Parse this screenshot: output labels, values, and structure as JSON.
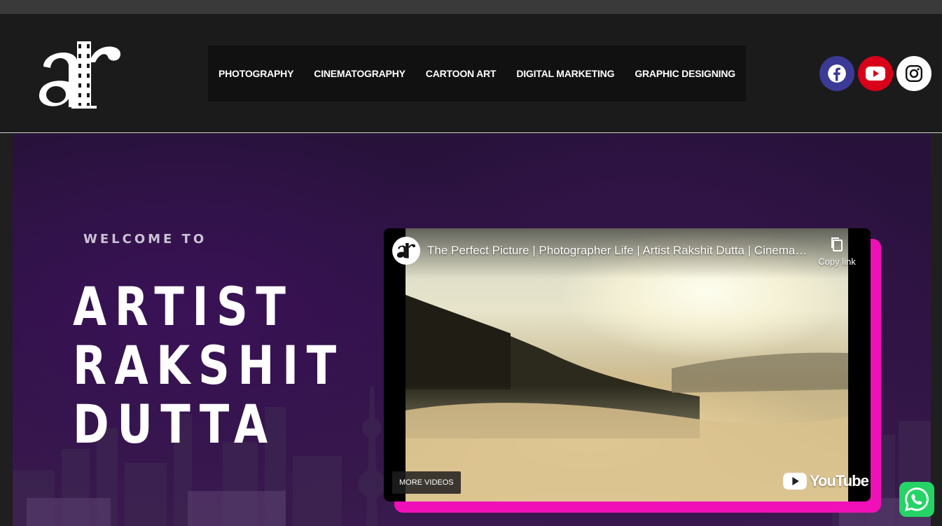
{
  "nav": {
    "items": [
      {
        "label": "PHOTOGRAPHY"
      },
      {
        "label": "CINEMATOGRAPHY"
      },
      {
        "label": "CARTOON ART"
      },
      {
        "label": "DIGITAL MARKETING"
      },
      {
        "label": "GRAPHIC DESIGNING"
      }
    ]
  },
  "social": {
    "facebook": {
      "icon": "facebook-icon",
      "color": "#3b3a96"
    },
    "youtube": {
      "icon": "youtube-icon",
      "color": "#d9001a"
    },
    "instagram": {
      "icon": "instagram-icon",
      "color": "#ffffff"
    }
  },
  "hero": {
    "welcome": "WELCOME TO",
    "title_lines": [
      "ARTIST",
      "RAKSHIT",
      "DUTTA"
    ]
  },
  "video": {
    "title": "The Perfect Picture | Photographer Life | Artist Rakshit Dutta | Cinematography",
    "copy_link": "Copy link",
    "more_videos": "MORE VIDEOS",
    "brand": "YouTube",
    "frame_accent": "#f010b8"
  },
  "whatsapp": {
    "icon": "whatsapp-icon",
    "color": "#25d366"
  }
}
